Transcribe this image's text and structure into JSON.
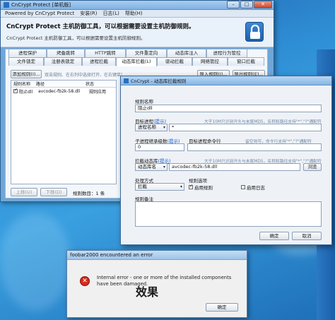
{
  "main_window": {
    "title": "CnCrypt Protect [单机版]",
    "menu": [
      "Powered by CnCrypt Protect",
      "安装(R)",
      "日志(L)",
      "帮助(H)"
    ],
    "banner_title": "CnCrypt Protect 主机防御工具，可以根据需要设置主机防御规则。",
    "banner_subtitle": "CnCrypt Protect 主机防御工具，可以根据需要设置主机防御规则。",
    "tabs_row1": [
      "进程保护",
      "烤备跳转",
      "HTTP跳转",
      "文件重定向",
      "动态库注入",
      "进程行为管控"
    ],
    "tabs_row2": [
      "文件锁定",
      "注册表锁定",
      "进程拦截",
      "动态库拦截(L)",
      "驱动拦截",
      "网络管控",
      "窗口拦截"
    ],
    "add_rule_button": "添加规则(I)...",
    "hint": "双击规则、在右列中选择打开、在右键菜单中打开",
    "import_button": "导入规则(I)...",
    "export_button": "导出规则(E)...",
    "columns": [
      "规则名称",
      "路径",
      "状态"
    ],
    "rows": [
      {
        "name": "阻止dll",
        "path": "avcodec-fb2k-58.dll",
        "status": "规则应用"
      }
    ],
    "up_button": "上移(U)",
    "down_button": "下移(D)",
    "rule_count": "规则数目：1 条"
  },
  "dialog": {
    "title": "CnCrypt - 动态库拦截规则",
    "rule_name_label": "规则名称",
    "rule_name_value": "阻止dll",
    "target_process_label": "目标进程",
    "target_process_link": "(提示)",
    "target_note": "大于10M只识别开头与末尾MD5，名称和路径支持\"*\",\"?\"通配符",
    "process_name_select": "进程名称",
    "process_name_value": "*",
    "child_level_label": "子进程继承级数",
    "child_level_link": "(提示)",
    "cmdline_label": "目标进程命令行",
    "cmdline_note": "留空则可，命令行支持\"*\",\"?\"通配符",
    "child_level_value": "0",
    "intercept_lib_label": "拦截动态库",
    "intercept_lib_link": "(提示)",
    "intercept_note": "大于10M只识别开头与末尾MD5，名称和路径支持\"*\",\"?\"通配符",
    "lib_select": "动态库名",
    "lib_value": "avcodec-fb2k-58.dll",
    "browse_button": "浏览",
    "action_label": "处理方式",
    "action_value": "拦截",
    "options_label": "规则选项",
    "enable_rule": "启用规则",
    "enable_log": "启用日志",
    "remark_label": "规则备注",
    "ok_button": "确定",
    "cancel_button": "取消"
  },
  "error_dialog": {
    "title": "foobar2000 encountered an error",
    "message": "Internal error - one or more of the installed components have been damaged.",
    "ok_button": "确定"
  },
  "overlay_text": "效果"
}
